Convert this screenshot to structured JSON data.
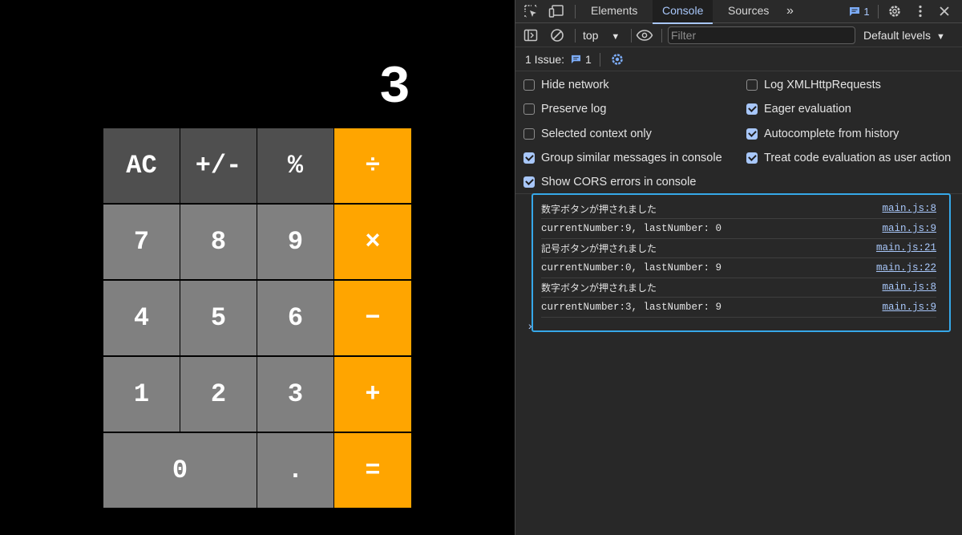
{
  "calculator": {
    "display": "3",
    "keys": [
      {
        "label": "AC",
        "type": "fn"
      },
      {
        "label": "+/-",
        "type": "fn"
      },
      {
        "label": "%",
        "type": "fn"
      },
      {
        "label": "÷",
        "type": "op"
      },
      {
        "label": "7",
        "type": "num"
      },
      {
        "label": "8",
        "type": "num"
      },
      {
        "label": "9",
        "type": "num"
      },
      {
        "label": "×",
        "type": "op"
      },
      {
        "label": "4",
        "type": "num"
      },
      {
        "label": "5",
        "type": "num"
      },
      {
        "label": "6",
        "type": "num"
      },
      {
        "label": "−",
        "type": "op"
      },
      {
        "label": "1",
        "type": "num"
      },
      {
        "label": "2",
        "type": "num"
      },
      {
        "label": "3",
        "type": "num"
      },
      {
        "label": "+",
        "type": "op"
      },
      {
        "label": "0",
        "type": "num"
      },
      {
        "label": ".",
        "type": "num"
      },
      {
        "label": "=",
        "type": "op"
      }
    ],
    "colors": {
      "function": "#4f4f4f",
      "number": "#808080",
      "operator": "#ffa500",
      "background": "#000000"
    }
  },
  "devtools": {
    "tabs": {
      "elements": "Elements",
      "console": "Console",
      "sources": "Sources",
      "more": "»"
    },
    "issues_badge": "1",
    "toolbar": {
      "context": "top",
      "filter_placeholder": "Filter",
      "levels": "Default levels"
    },
    "issues_bar": {
      "label": "1 Issue:",
      "count": "1"
    },
    "settings": {
      "hide_network": "Hide network",
      "preserve_log": "Preserve log",
      "selected_context": "Selected context only",
      "group_similar": "Group similar messages in console",
      "show_cors": "Show CORS errors in console",
      "log_xhr": "Log XMLHttpRequests",
      "eager_eval": "Eager evaluation",
      "autocomplete": "Autocomplete from history",
      "treat_code_eval": "Treat code evaluation as user action"
    },
    "logs": [
      {
        "message": "数字ボタンが押されました",
        "source": "main.js:8"
      },
      {
        "message": "currentNumber:9, lastNumber: 0",
        "source": "main.js:9"
      },
      {
        "message": "記号ボタンが押されました",
        "source": "main.js:21"
      },
      {
        "message": "currentNumber:0, lastNumber: 9",
        "source": "main.js:22"
      },
      {
        "message": "数字ボタンが押されました",
        "source": "main.js:8"
      },
      {
        "message": "currentNumber:3, lastNumber: 9",
        "source": "main.js:9"
      }
    ],
    "accent": "#a8c7fa",
    "focus_border": "#36a8e9"
  }
}
